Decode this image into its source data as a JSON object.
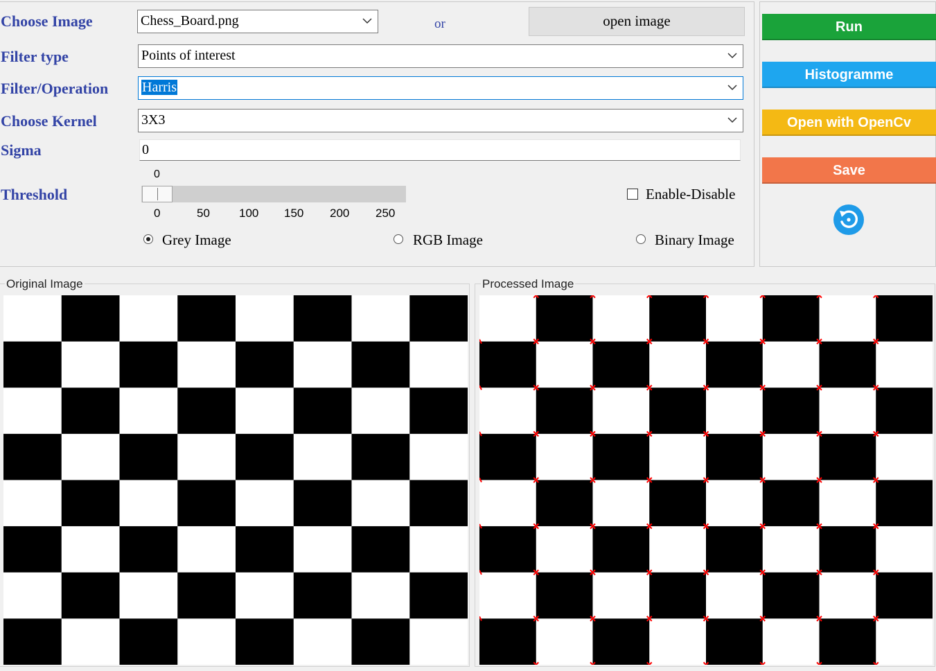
{
  "form": {
    "choose_image": {
      "label": "Choose Image",
      "value": "Chess_Board.png"
    },
    "or_label": "or",
    "open_image_button": "open image",
    "filter_type": {
      "label": "Filter type",
      "value": "Points of interest"
    },
    "filter_operation": {
      "label": "Filter/Operation",
      "value": "Harris"
    },
    "kernel": {
      "label": "Choose Kernel",
      "value": "3X3"
    },
    "sigma": {
      "label": "Sigma",
      "value": "0"
    },
    "threshold": {
      "label": "Threshold",
      "value": "0",
      "min": 0,
      "max": 255,
      "ticks": [
        "0",
        "50",
        "100",
        "150",
        "200",
        "250"
      ]
    },
    "enable_checkbox": {
      "label": "Enable-Disable",
      "checked": false
    },
    "image_mode": {
      "options": [
        "Grey Image",
        "RGB Image",
        "Binary Image"
      ],
      "selected": "Grey Image"
    }
  },
  "actions": {
    "run": {
      "label": "Run",
      "color": "#1aa33a"
    },
    "histogram": {
      "label": "Histogramme",
      "color": "#1ea6ef"
    },
    "opencv": {
      "label": "Open with OpenCv",
      "color": "#f4b914"
    },
    "save": {
      "label": "Save",
      "color": "#f2764a"
    },
    "refresh_icon": "refresh-icon"
  },
  "panels": {
    "original": {
      "title": "Original Image",
      "board": {
        "rows": 8,
        "cols": 8,
        "top_left": "white"
      }
    },
    "processed": {
      "title": "Processed Image",
      "board": {
        "rows": 8,
        "cols": 8,
        "top_left": "white"
      },
      "corner_marker_color": "#ff0000"
    }
  },
  "colors": {
    "label_blue": "#3344a6",
    "selection_blue": "#0078d7"
  }
}
